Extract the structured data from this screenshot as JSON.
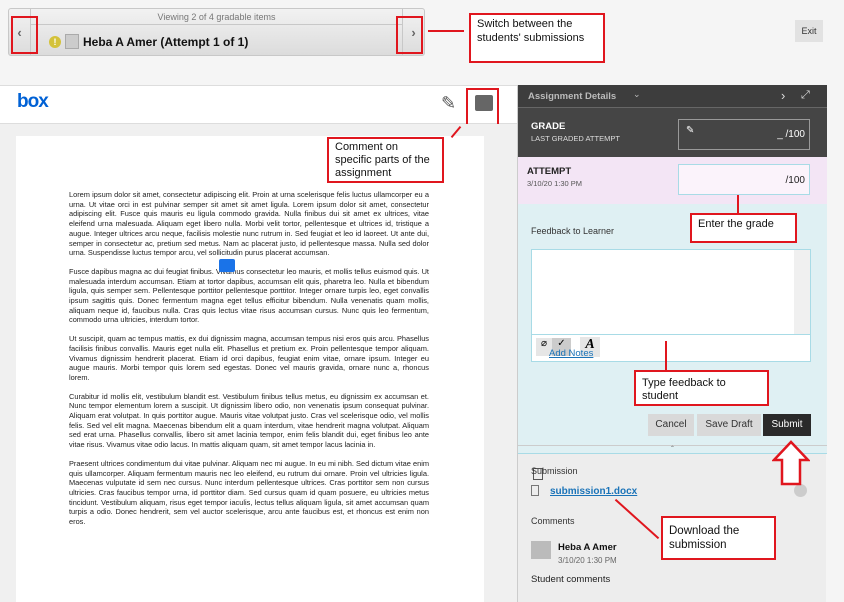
{
  "nav": {
    "viewing": "Viewing 2 of 4 gradable items",
    "student": "Heba A Amer (Attempt 1 of 1)",
    "prev": "‹",
    "next": "›"
  },
  "exit_label": "Exit",
  "viewer": {
    "logo": "box"
  },
  "document": {
    "paragraphs": [
      "Lorem ipsum dolor sit amet, consectetur adipiscing elit. Proin at urna scelerisque felis luctus ullamcorper eu a urna. Ut vitae orci in est pulvinar semper sit amet sit amet ligula. Lorem ipsum dolor sit amet, consectetur adipiscing elit. Fusce quis mauris eu ligula commodo gravida. Nulla finibus dui sit amet ex ultrices, vitae eleifend urna malesuada. Aliquam eget libero nulla. Morbi velit tortor, pellentesque et ultrices id, tristique a augue. Integer ultrices arcu neque, facilisis molestie nunc rutrum in. Sed feugiat et leo id laoreet. Ut ante dui, semper in consectetur ac, pretium sed metus. Nam ac placerat justo, id pellentesque massa. Nulla sed dolor urna. Suspendisse luctus tempor arcu, vel sollicitudin purus placerat accumsan.",
      "Fusce dapibus magna ac dui feugiat finibus. Vivamus consectetur leo mauris, et mollis tellus euismod quis. Ut malesuada interdum accumsan. Etiam at tortor dapibus, accumsan elit quis, pharetra leo. Nulla et bibendum ligula, quis semper sem. Pellentesque porttitor pellentesque porttitor. Integer ornare turpis leo, eget convallis ipsum sagittis quis. Donec fermentum magna eget tellus efficitur bibendum. Nulla venenatis quam mollis, aliquam neque id, faucibus nulla. Cras quis lectus vitae risus accumsan cursus. Nunc quis leo fermentum, commodo urna ultricies, interdum tortor.",
      "Ut suscipit, quam ac tempus mattis, ex dui dignissim magna, accumsan tempus nisi eros quis arcu. Phasellus facilisis finibus convallis. Mauris eget nulla elit. Phasellus et pretium ex. Proin pellentesque tempor aliquam. Vivamus dignissim hendrerit placerat. Etiam id orci dapibus, feugiat enim vitae, ornare ipsum. Integer eu augue mauris. Morbi tempor quis lorem sed egestas. Donec vel mauris gravida, ornare nunc a, rhoncus lorem.",
      "Curabitur id mollis elit, vestibulum blandit est. Vestibulum finibus tellus metus, eu dignissim ex accumsan et. Nunc tempor elementum lorem a suscipit. Ut dignissim libero odio, non venenatis ipsum consequat pulvinar. Aliquam erat volutpat. In quis porttitor augue. Mauris vitae volutpat justo. Cras vel scelerisque odio, vel mollis felis. Sed vel elit magna. Maecenas bibendum elit a quam interdum, vitae hendrerit magna volutpat. Aliquam sed erat urna. Phasellus convallis, libero sit amet lacinia tempor, enim felis blandit dui, eget finibus leo ante vitae risus. Vivamus vitae odio lacus. In mattis aliquam quam, sit amet tempor lacus lacinia in.",
      "Praesent ultrices condimentum dui vitae pulvinar. Aliquam nec mi augue. In eu mi nibh. Sed dictum vitae enim quis ullamcorper. Aliquam fermentum mauris nec leo eleifend, eu rutrum dui ornare. Proin vel ultricies ligula. Maecenas vulputate id sem nec cursus. Nunc interdum pellentesque ultrices. Cras porttitor sem non cursus ultricies. Cras faucibus tempor urna, id porttitor diam. Sed cursus quam id quam posuere, eu ultricies metus tincidunt. Vestibulum aliquam, risus eget tempor iaculis, lectus tellus aliquam ligula, sit amet accumsan quam turpis a odio. Donec hendrerit, sem vel auctor scelerisque, arcu ante faucibus est, et rhoncus est enim non eros."
    ]
  },
  "panel": {
    "header": "Assignment Details",
    "grade_label": "GRADE",
    "grade_sub": "LAST GRADED ATTEMPT",
    "grade_value": "_ /100",
    "attempt_label": "ATTEMPT",
    "attempt_date": "3/10/20 1:30 PM",
    "attempt_value": "/100",
    "feedback_label": "Feedback to Learner",
    "add_notes": "Add Notes",
    "cancel": "Cancel",
    "save_draft": "Save Draft",
    "submit": "Submit",
    "submission_label": "Submission",
    "file": "submission1.docx",
    "comments_label": "Comments",
    "commenter": "Heba A Amer",
    "comment_date": "3/10/20 1:30 PM",
    "comment_text": "Student comments"
  },
  "annotations": {
    "switch": "Switch between the students' submissions",
    "comment": "Comment on specific parts of the assignment",
    "grade": "Enter the  grade",
    "feedback": "Type feedback to student",
    "download": "Download the submission"
  },
  "colors": {
    "annotation": "#e0161e",
    "panel_dark": "#3d3d3d",
    "attempt_bg": "#f3e5f5",
    "feedback_bg": "#dff0f3",
    "box_blue": "#0061d5"
  }
}
